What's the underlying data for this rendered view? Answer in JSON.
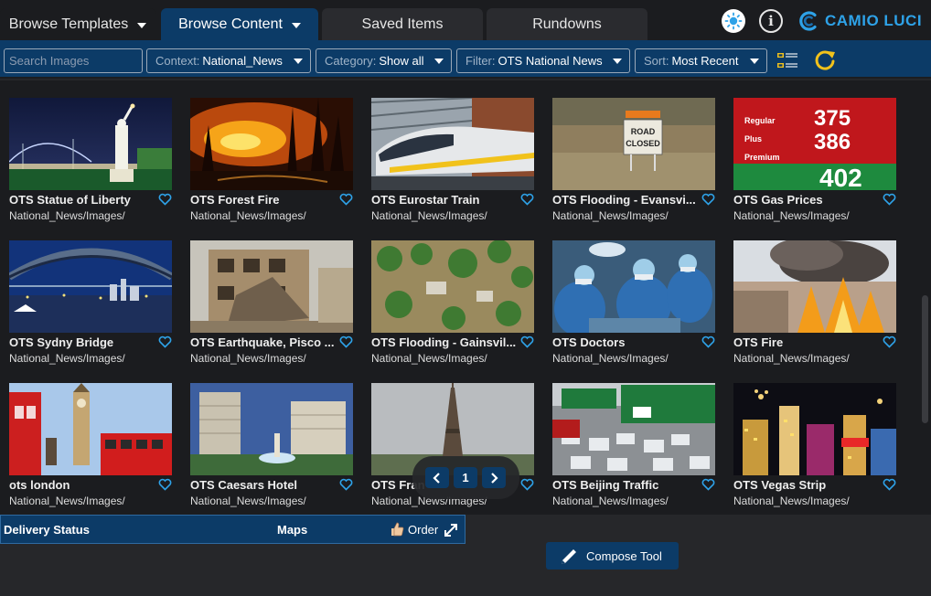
{
  "tabs": {
    "browse_templates": "Browse Templates",
    "browse_content": "Browse Content",
    "saved_items": "Saved Items",
    "rundowns": "Rundowns"
  },
  "brand": {
    "name": "CAMIO LUCI",
    "accent": "#2ea2e8"
  },
  "filters": {
    "search_placeholder": "Search Images",
    "context": {
      "label": "Context:",
      "value": "National_News"
    },
    "category": {
      "label": "Category:",
      "value": "Show all"
    },
    "filter": {
      "label": "Filter:",
      "value": "OTS National News"
    },
    "sort": {
      "label": "Sort:",
      "value": "Most Recent"
    }
  },
  "items": [
    {
      "title": "OTS Statue of Liberty",
      "path": "National_News/Images/"
    },
    {
      "title": "OTS Forest Fire",
      "path": "National_News/Images/"
    },
    {
      "title": "OTS Eurostar Train",
      "path": "National_News/Images/"
    },
    {
      "title": "OTS Flooding - Evansvi...",
      "path": "National_News/Images/"
    },
    {
      "title": "OTS Gas Prices",
      "path": "National_News/Images/"
    },
    {
      "title": "OTS Sydny Bridge",
      "path": "National_News/Images/"
    },
    {
      "title": "OTS Earthquake, Pisco ...",
      "path": "National_News/Images/"
    },
    {
      "title": "OTS Flooding - Gainsvil...",
      "path": "National_News/Images/"
    },
    {
      "title": "OTS Doctors",
      "path": "National_News/Images/"
    },
    {
      "title": "OTS Fire",
      "path": "National_News/Images/"
    },
    {
      "title": "ots london",
      "path": "National_News/Images/"
    },
    {
      "title": "OTS Caesars Hotel",
      "path": "National_News/Images/"
    },
    {
      "title": "OTS Fran",
      "path": "National_News/Images/"
    },
    {
      "title": "OTS Beijing Traffic",
      "path": "National_News/Images/"
    },
    {
      "title": "OTS Vegas Strip",
      "path": "National_News/Images/"
    }
  ],
  "thumb_text": {
    "road_sign": [
      "ROAD",
      "CLOSED"
    ],
    "gas_prices": [
      "Regular",
      "Plus",
      "Premium",
      "375",
      "386",
      "402"
    ]
  },
  "pagination": {
    "current_page": "1"
  },
  "bottom": {
    "delivery_status": "Delivery Status",
    "maps": "Maps",
    "order": "Order"
  },
  "compose_tool": "Compose Tool",
  "colors": {
    "bar_blue": "#0c3b67",
    "heart": "#2ea2e8",
    "refresh": "#f2c21b"
  }
}
